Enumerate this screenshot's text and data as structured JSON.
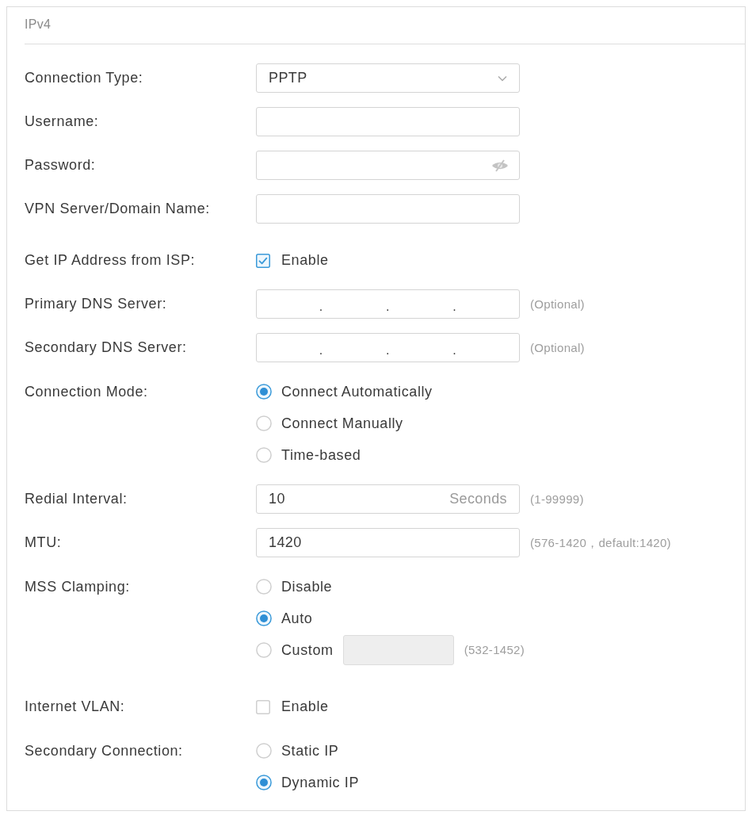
{
  "panel": {
    "title": "IPv4"
  },
  "rows": [
    {
      "kind": "select",
      "label": "Connection Type:",
      "value": "PPTP"
    },
    {
      "kind": "text",
      "label": "Username:"
    },
    {
      "kind": "password",
      "label": "Password:"
    },
    {
      "kind": "text",
      "label": "VPN Server/Domain Name:"
    },
    {
      "kind": "checkbox",
      "label": "Get IP Address from ISP:",
      "option": "Enable",
      "checked": true
    },
    {
      "kind": "ip",
      "label": "Primary DNS Server:",
      "separators": [
        ".",
        ".",
        "."
      ],
      "hint": "(Optional)"
    },
    {
      "kind": "ip",
      "label": "Secondary DNS Server:",
      "separators": [
        ".",
        ".",
        "."
      ],
      "hint": "(Optional)"
    },
    {
      "kind": "radio",
      "label": "Connection Mode:",
      "options": [
        {
          "label": "Connect Automatically",
          "selected": true
        },
        {
          "label": "Connect Manually",
          "selected": false
        },
        {
          "label": "Time-based",
          "selected": false
        }
      ]
    },
    {
      "kind": "text",
      "label": "Redial Interval:",
      "value": "10",
      "unit": "Seconds",
      "hint": "(1-99999)"
    },
    {
      "kind": "text",
      "label": "MTU:",
      "value": "1420",
      "hint": "(576-1420，default:1420)"
    },
    {
      "kind": "radio",
      "label": "MSS Clamping:",
      "options": [
        {
          "label": "Disable",
          "selected": false
        },
        {
          "label": "Auto",
          "selected": true
        },
        {
          "label": "Custom",
          "selected": false,
          "field": {
            "disabled": true
          },
          "hint": "(532-1452)"
        }
      ]
    },
    {
      "kind": "checkbox",
      "label": "Internet VLAN:",
      "option": "Enable",
      "checked": false
    },
    {
      "kind": "radio",
      "label": "Secondary Connection:",
      "options": [
        {
          "label": "Static IP",
          "selected": false
        },
        {
          "label": "Dynamic IP",
          "selected": true
        }
      ]
    }
  ]
}
